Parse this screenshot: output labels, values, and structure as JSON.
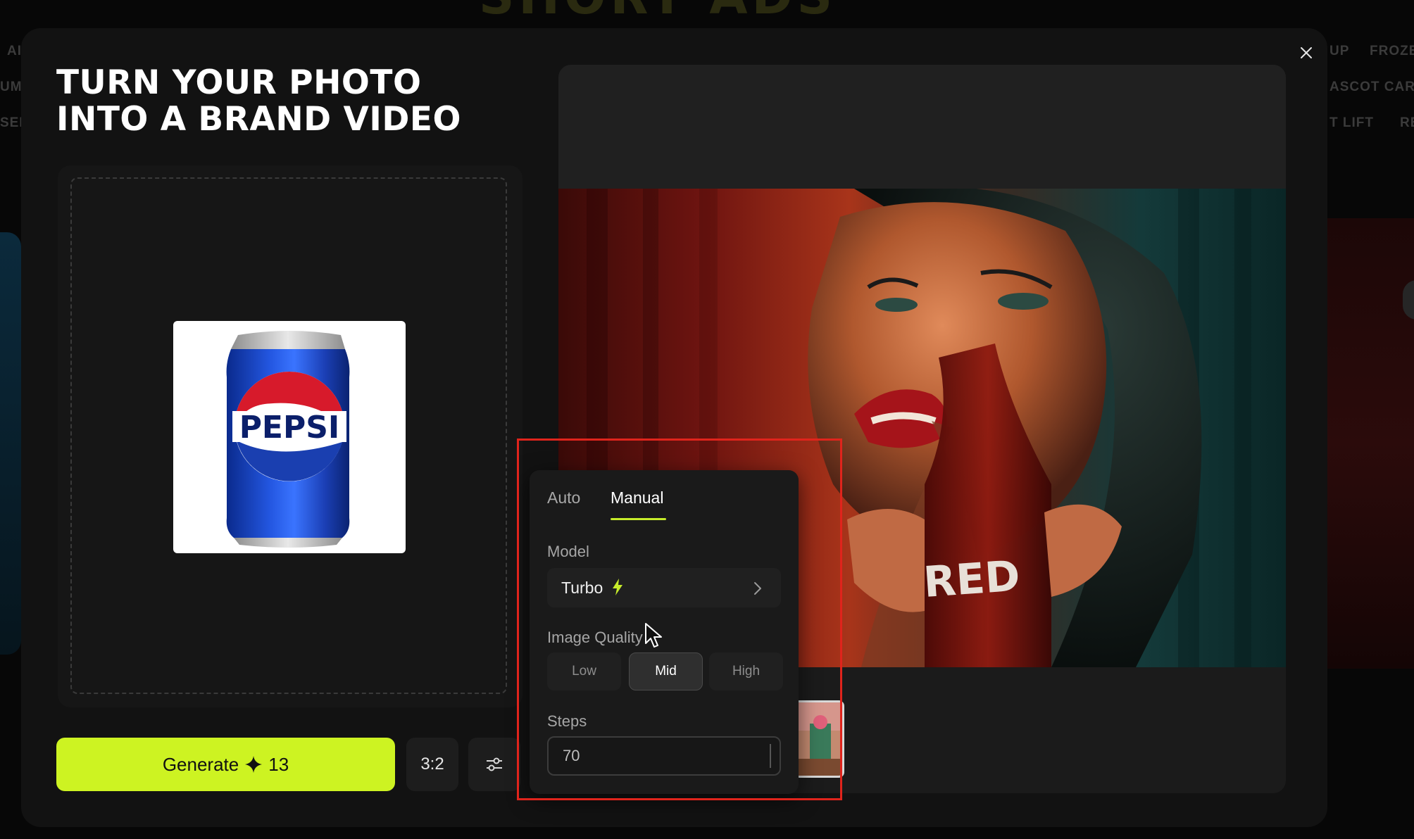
{
  "background": {
    "hero_text": "SHORT ADS",
    "chips": [
      "AI",
      "UP",
      "FROZE",
      "UM",
      "ASCOT CART",
      "SER",
      "T LIFT",
      "RE"
    ]
  },
  "modal": {
    "close_icon": "close-icon",
    "title_line1": "TURN YOUR PHOTO",
    "title_line2": "INTO A BRAND VIDEO"
  },
  "upload": {
    "product_label": "PEPSI"
  },
  "controls": {
    "generate_label": "Generate",
    "generate_credits": "13",
    "aspect_ratio": "3:2",
    "settings_icon": "sliders-icon"
  },
  "preview": {
    "bottle_text": "RED"
  },
  "settings_panel": {
    "tabs": [
      {
        "label": "Auto",
        "active": false
      },
      {
        "label": "Manual",
        "active": true
      }
    ],
    "model_label": "Model",
    "model_value": "Turbo",
    "image_quality_label": "Image Quality",
    "quality_options": [
      "Low",
      "Mid",
      "High"
    ],
    "quality_selected": "Mid",
    "steps_label": "Steps",
    "steps_value": "70"
  },
  "colors": {
    "accent": "#cdf322",
    "highlight": "#e0241c",
    "modal_bg": "#121212"
  }
}
